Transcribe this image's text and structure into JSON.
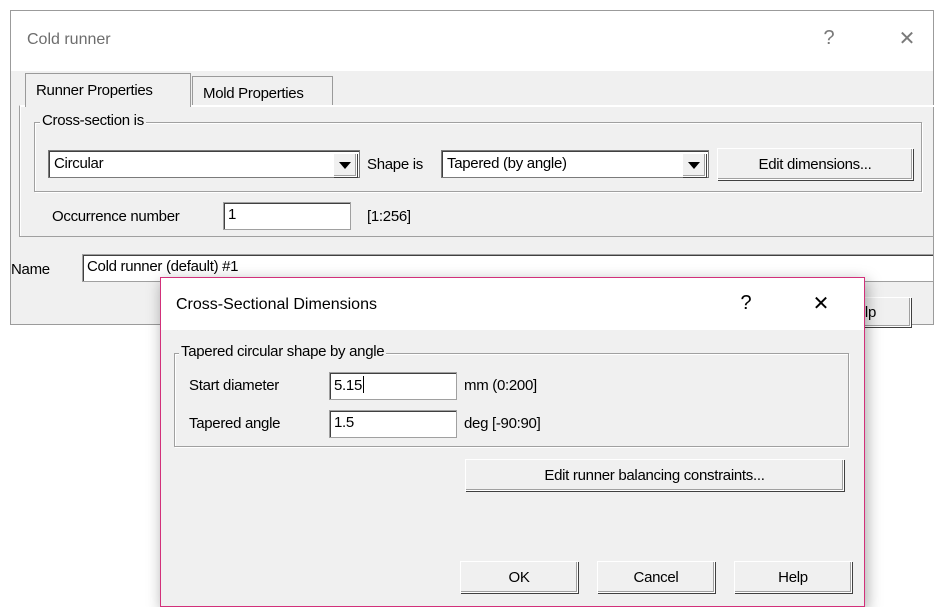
{
  "back_dialog": {
    "title": "Cold runner",
    "help_glyph": "?",
    "close_glyph": "✕",
    "tabs": [
      {
        "label": "Runner Properties",
        "active": true
      },
      {
        "label": "Mold Properties",
        "active": false
      }
    ],
    "cross_section": {
      "group_label": "Cross-section is",
      "cross_section_value": "Circular",
      "shape_label": "Shape is",
      "shape_value": "Tapered (by angle)",
      "edit_dimensions_label": "Edit dimensions..."
    },
    "occurrence": {
      "label": "Occurrence number",
      "value": "1",
      "range": "[1:256]"
    },
    "name": {
      "label": "Name",
      "value": "Cold runner (default) #1"
    },
    "help_button_partial": "Help"
  },
  "front_dialog": {
    "title": "Cross-Sectional Dimensions",
    "help_glyph": "?",
    "close_glyph": "✕",
    "group_label": "Tapered circular shape by angle",
    "start_diameter": {
      "label": "Start diameter",
      "value": "5.15",
      "unit_range": "mm (0:200]"
    },
    "tapered_angle": {
      "label": "Tapered angle",
      "value": "1.5",
      "unit_range": "deg [-90:90]"
    },
    "balancing_button_label": "Edit runner balancing constraints...",
    "ok_label": "OK",
    "cancel_label": "Cancel",
    "help_label": "Help"
  },
  "icons": {
    "dropdown_arrow": "chevron-down-icon",
    "help": "help-icon",
    "close": "close-icon"
  },
  "colors": {
    "dialog_bg": "#f0f0f0",
    "titlebar_bg": "#ffffff",
    "active_border": "#d2307a"
  }
}
